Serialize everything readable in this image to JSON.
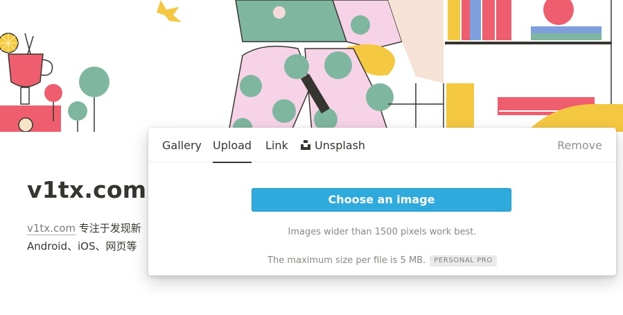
{
  "page": {
    "title": "v1tx.com",
    "description_link": "v1tx.com",
    "description_line1": " 专注于发现新",
    "description_line2": "Android、iOS、网页等"
  },
  "image_picker": {
    "tabs": [
      {
        "label": "Gallery",
        "active": false
      },
      {
        "label": "Upload",
        "active": true
      },
      {
        "label": "Link",
        "active": false
      },
      {
        "label": "Unsplash",
        "active": false,
        "icon": "unsplash-icon"
      }
    ],
    "remove_label": "Remove",
    "choose_button_label": "Choose an image",
    "hint": "Images wider than 1500 pixels work best.",
    "max_size_text": "The maximum size per file is 5 MB.",
    "plan_badge": "PERSONAL PRO"
  },
  "colors": {
    "accent_button": "#2eaadc",
    "text": "#37352f"
  }
}
